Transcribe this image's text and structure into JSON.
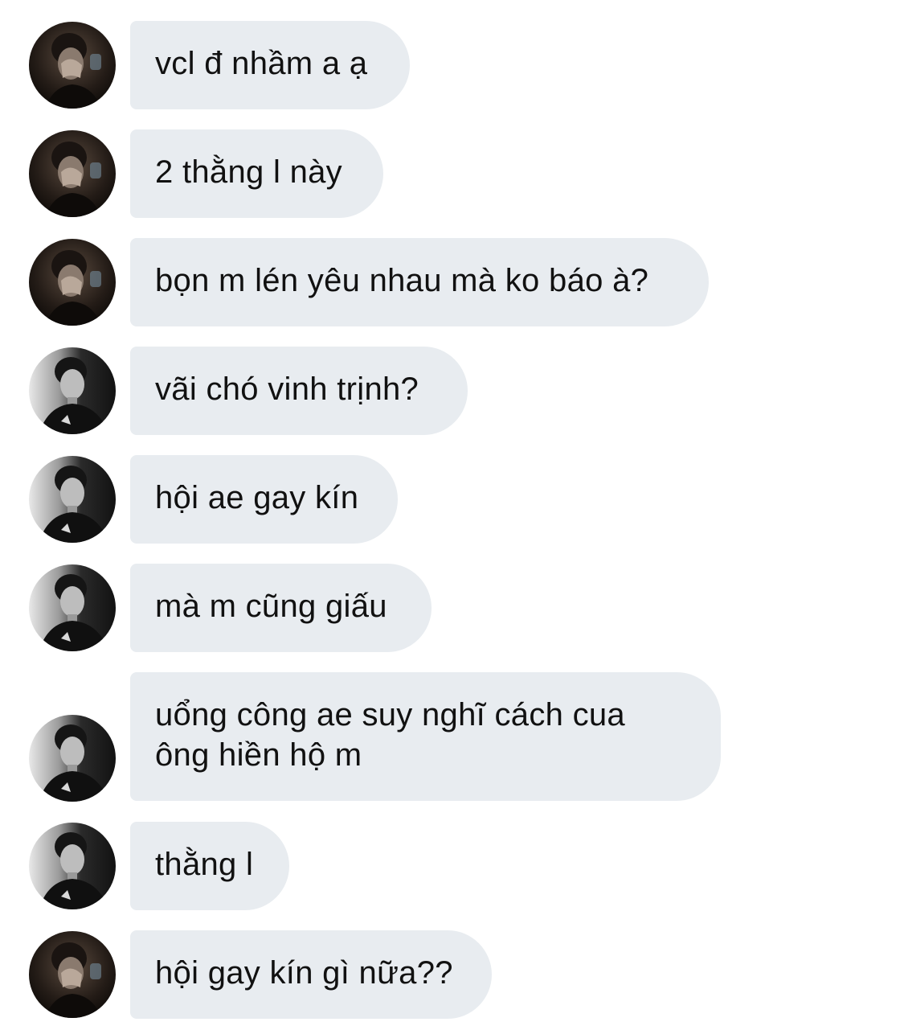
{
  "conversation": {
    "messages": [
      {
        "sender": "user-a",
        "avatar_icon": "person-covering-face-avatar-icon",
        "text": "vcl đ nhầm a ạ"
      },
      {
        "sender": "user-a",
        "avatar_icon": "person-covering-face-avatar-icon",
        "text": "2 thằng l này"
      },
      {
        "sender": "user-a",
        "avatar_icon": "person-covering-face-avatar-icon",
        "text": "bọn m lén yêu nhau mà ko báo à?"
      },
      {
        "sender": "user-b",
        "avatar_icon": "man-in-black-avatar-icon",
        "text": "vãi chó vinh trịnh?"
      },
      {
        "sender": "user-b",
        "avatar_icon": "man-in-black-avatar-icon",
        "text": "hội ae gay kín"
      },
      {
        "sender": "user-b",
        "avatar_icon": "man-in-black-avatar-icon",
        "text": "mà m cũng giấu"
      },
      {
        "sender": "user-b",
        "avatar_icon": "man-in-black-avatar-icon",
        "text": "uổng công ae suy nghĩ cách cua\nông hiền hộ m"
      },
      {
        "sender": "user-b",
        "avatar_icon": "man-in-black-avatar-icon",
        "text": "thằng l"
      },
      {
        "sender": "user-a",
        "avatar_icon": "person-covering-face-avatar-icon",
        "text": "hội gay kín gì nữa??"
      }
    ]
  },
  "colors": {
    "bubble_background": "#e8ecf0",
    "text": "#111111",
    "page_background": "#ffffff"
  }
}
